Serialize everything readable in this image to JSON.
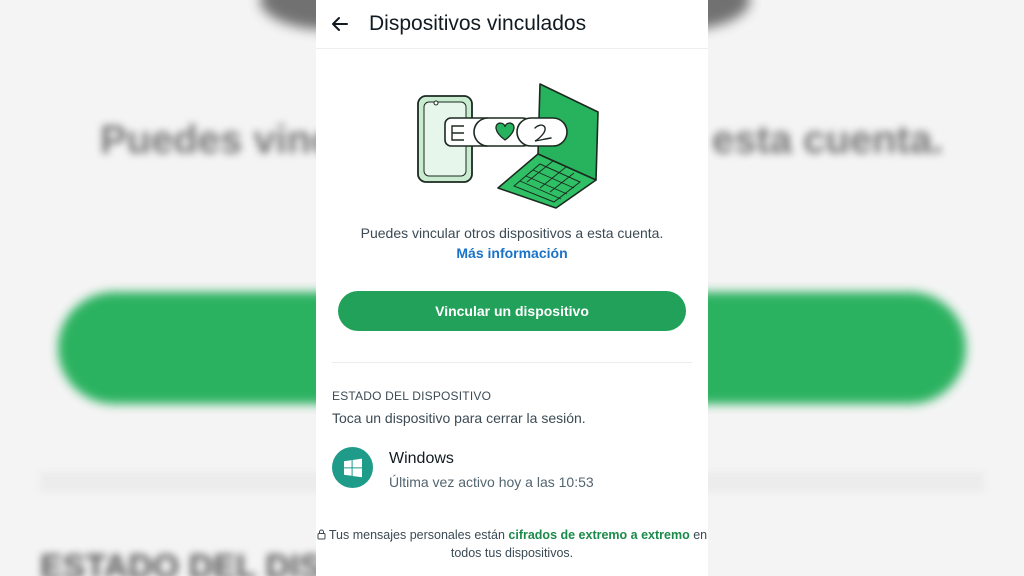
{
  "backdrop": {
    "left_text": "Puedes vincul",
    "right_text": "esta cuenta.",
    "bottom_left_text": "ESTADO DEL DISPO"
  },
  "header": {
    "title": "Dispositivos vinculados",
    "back_icon": "arrow-left-icon"
  },
  "intro": {
    "description": "Puedes vincular otros dispositivos a esta cuenta.",
    "more_info_link": "Más información"
  },
  "primary_action": {
    "label": "Vincular un dispositivo"
  },
  "device_status": {
    "header": "ESTADO DEL DISPOSITIVO",
    "hint": "Toca un dispositivo para cerrar la sesión.",
    "devices": [
      {
        "name": "Windows",
        "status": "Última vez activo hoy a las 10:53",
        "icon": "windows-logo-icon"
      }
    ]
  },
  "footer": {
    "prefix": "Tus mensajes personales están ",
    "highlight": "cifrados de extremo a extremo",
    "suffix": " en todos tus dispositivos.",
    "icon": "lock-icon"
  },
  "colors": {
    "accent_green": "#21a15a",
    "link_blue": "#1a73c8",
    "windows_icon_bg": "#1f9b8a",
    "footer_highlight": "#1a8a4a"
  }
}
